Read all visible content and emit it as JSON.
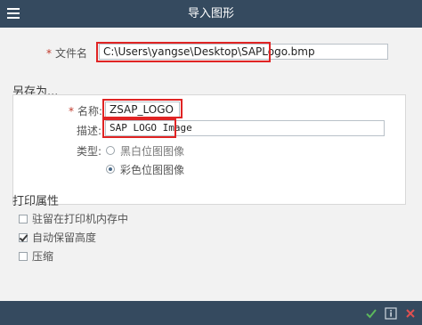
{
  "window": {
    "title": "导入图形"
  },
  "file": {
    "label": "文件名",
    "value": "C:\\Users\\yangse\\Desktop\\SAPLogo.bmp"
  },
  "save_as": {
    "title": "另存为...",
    "name_label": "名称:",
    "name_value": "ZSAP_LOGO",
    "desc_label": "描述:",
    "desc_value": "SAP LOGO Image",
    "type_label": "类型:",
    "types": [
      {
        "label": "黑白位图图像",
        "selected": false
      },
      {
        "label": "彩色位图图像",
        "selected": true
      }
    ]
  },
  "print": {
    "title": "打印属性",
    "options": [
      {
        "label": "驻留在打印机内存中",
        "checked": false
      },
      {
        "label": "自动保留高度",
        "checked": true
      },
      {
        "label": "压缩",
        "checked": false
      }
    ]
  },
  "colors": {
    "header": "#354a5f",
    "highlight": "#e02424",
    "check_green": "#5cb85c"
  }
}
